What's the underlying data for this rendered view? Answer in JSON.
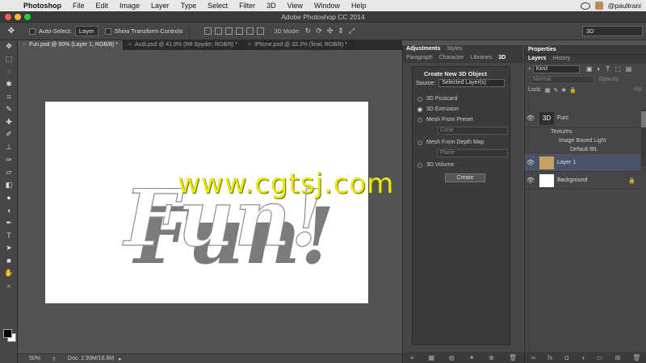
{
  "menubar": {
    "app": "Photoshop",
    "items": [
      "File",
      "Edit",
      "Image",
      "Layer",
      "Type",
      "Select",
      "Filter",
      "3D",
      "View",
      "Window",
      "Help"
    ],
    "user": "@paultrani"
  },
  "window": {
    "title": "Adobe Photoshop CC 2014"
  },
  "options": {
    "auto_select_label": "Auto-Select:",
    "auto_select_value": "Layer",
    "show_transform": "Show Transform Controls",
    "mode_label": "3D Mode:",
    "workspace": "3D"
  },
  "tabs": [
    {
      "label": "Fun.psd @ 50% (Layer 1, RGB/8) *",
      "active": true
    },
    {
      "label": "Audi.psd @ 41.9% (R8 Spyder, RGB/8) *",
      "active": false
    },
    {
      "label": "iPhone.psd @ 33.3% (final, RGB/8) *",
      "active": false
    }
  ],
  "status": {
    "zoom": "50%",
    "doc": "Doc: 2.93M/10.6M"
  },
  "panel3d": {
    "tabs_top": [
      "Adjustments",
      "Styles"
    ],
    "tabs": [
      "Paragraph",
      "Character",
      "Libraries",
      "3D"
    ],
    "header": "Create New 3D Object",
    "source_label": "Source:",
    "source_value": "Selected Layer(s)",
    "options": [
      "3D Postcard",
      "3D Extrusion",
      "Mesh From Preset",
      "Mesh From Depth Map",
      "3D Volume"
    ],
    "preset_value": "Cone",
    "depth_value": "Plane",
    "create_label": "Create"
  },
  "layers_panel": {
    "properties_label": "Properties",
    "tabs": [
      "Layers",
      "History"
    ],
    "kind": "Kind",
    "blend": "Normal",
    "opacity_label": "Opacity:",
    "lock_label": "Lock:",
    "fill_label": "Fill:",
    "layers": [
      {
        "name": "Fun!"
      },
      {
        "name": "Layer 1"
      },
      {
        "name": "Background"
      }
    ],
    "sub": [
      "Textures",
      "Image Based Light",
      "Default IBL"
    ]
  },
  "canvas": {
    "art_text": "Fun!"
  },
  "watermark": "www.cgtsj.com"
}
